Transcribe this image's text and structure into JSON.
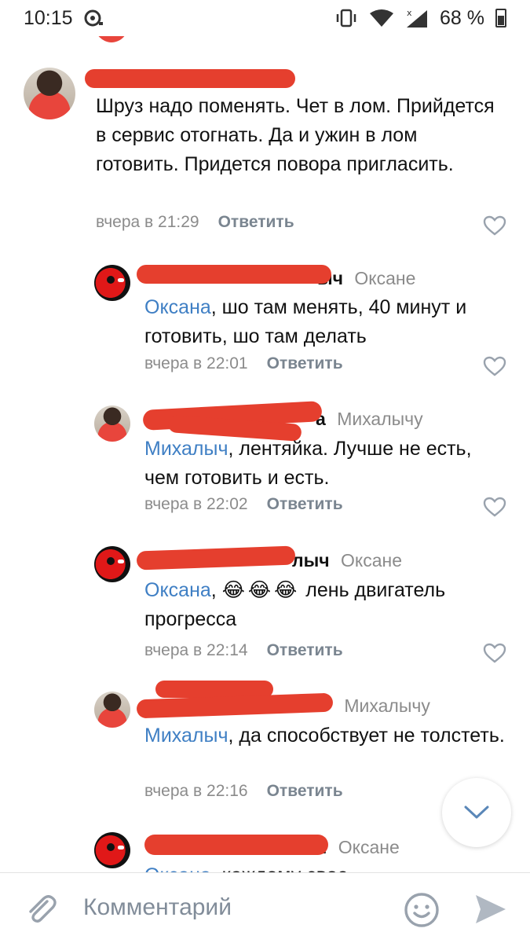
{
  "status_bar": {
    "time": "10:15",
    "battery_text": "68 %"
  },
  "comments": [
    {
      "author_suffix": "",
      "text": "Шруз надо поменять. Чет в лом. Прийдется в сервис отогнать. Да и ужин в лом готовить. Придется повора пригласить.",
      "time": "вчера в 21:29",
      "reply_label": "Ответить"
    },
    {
      "author_suffix": "ыч",
      "reply_to": "Оксане",
      "mention": "Оксана",
      "text": ", шо там менять,  40 минут и готовить,  шо там делать",
      "time": "вчера в 22:01",
      "reply_label": "Ответить"
    },
    {
      "author_suffix": "а",
      "reply_to": "Михалычу",
      "mention": "Михалыч",
      "text": ", лентяйка. Лучше не есть, чем готовить и есть.",
      "time": "вчера в 22:02",
      "reply_label": "Ответить"
    },
    {
      "author_suffix": "лыч",
      "reply_to": "Оксане",
      "mention": "Оксана",
      "emoji": "😂😂😂",
      "text": " лень двигатель прогресса",
      "time": "вчера в 22:14",
      "reply_label": "Ответить"
    },
    {
      "author_suffix": "",
      "reply_to": "Михалычу",
      "mention": "Михалыч",
      "text": ", да способствует не толстеть.",
      "time": "вчера в 22:16",
      "reply_label": "Ответить"
    },
    {
      "author_suffix": "ı",
      "reply_to": "Оксане",
      "mention": "Оксана",
      "text": ", каждому свое"
    }
  ],
  "composer": {
    "placeholder": "Комментарий"
  },
  "colors": {
    "mention": "#3f7fc4",
    "redaction": "#e53f2e",
    "meta": "#8b8b8b"
  }
}
